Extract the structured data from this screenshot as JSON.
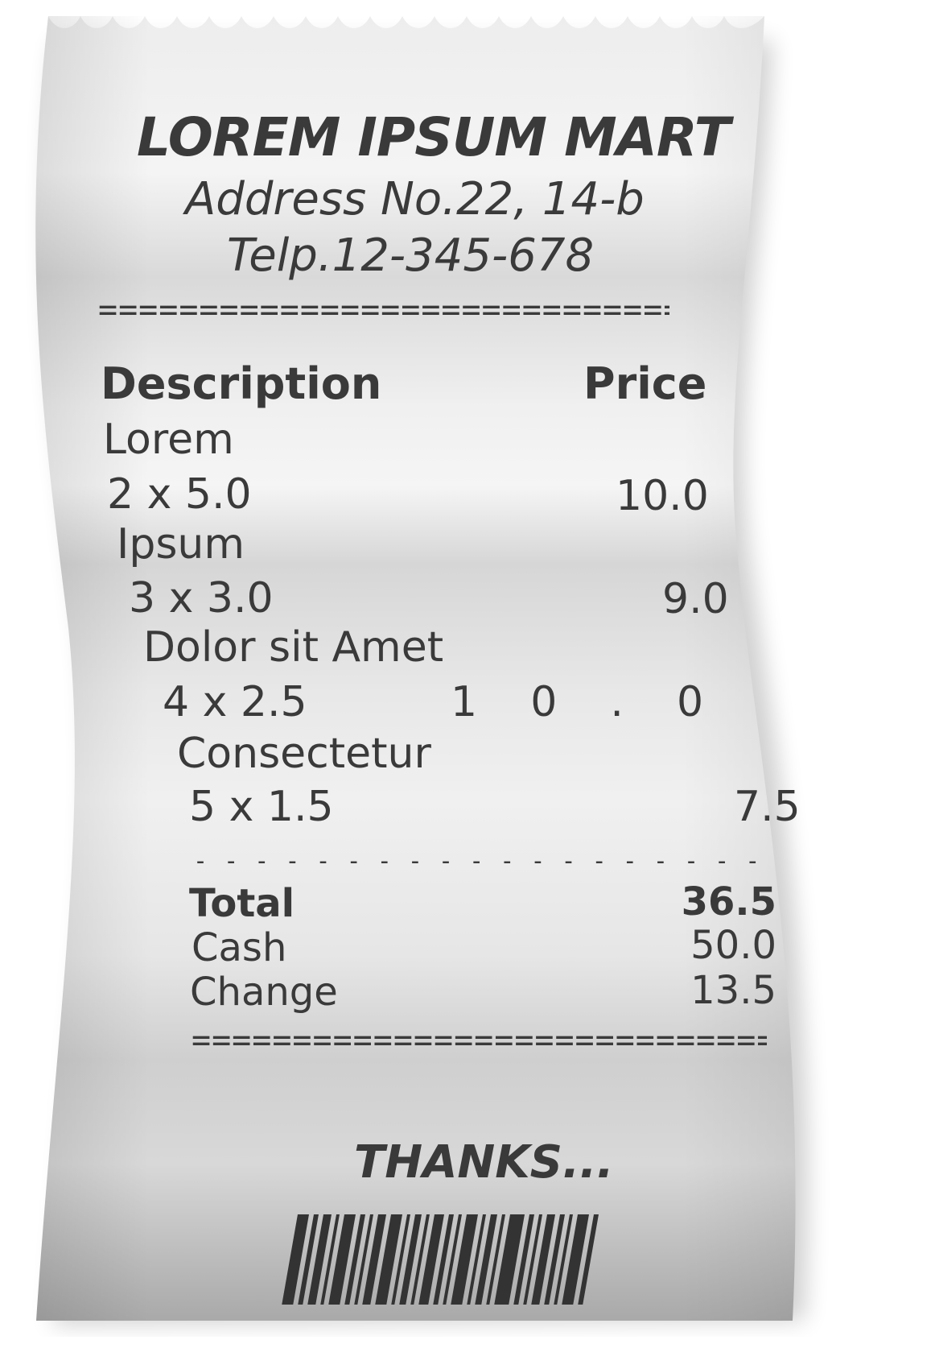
{
  "store": {
    "name": "LOREM IPSUM MART",
    "address": "Address No.22, 14-b",
    "phone": "Telp.12-345-678"
  },
  "separators": {
    "double": "=============================",
    "single": "- - - - - - - - - - - - - - - - - - - - - - - - - -"
  },
  "columns": {
    "description": "Description",
    "price": "Price"
  },
  "items": [
    {
      "name": "Lorem",
      "qty_line": "2 x 5.0",
      "price": "10.0"
    },
    {
      "name": "Ipsum",
      "qty_line": "3 x 3.0",
      "price": "9.0"
    },
    {
      "name": "Dolor sit Amet",
      "qty_line": "4 x 2.5",
      "price": "1    0    .    0"
    },
    {
      "name": "Consectetur",
      "qty_line": "5 x 1.5",
      "price": "7.5"
    }
  ],
  "summary": {
    "total_label": "Total",
    "total_value": "36.5",
    "cash_label": "Cash",
    "cash_value": "50.0",
    "change_label": "Change",
    "change_value": "13.5"
  },
  "footer": {
    "thanks": "THANKS...",
    "barcode_icon": "barcode-icon"
  },
  "colors": {
    "ink": "#3a3a3a",
    "paper_light": "#f2f2f2",
    "paper_shadow": "#a8a8a8"
  }
}
